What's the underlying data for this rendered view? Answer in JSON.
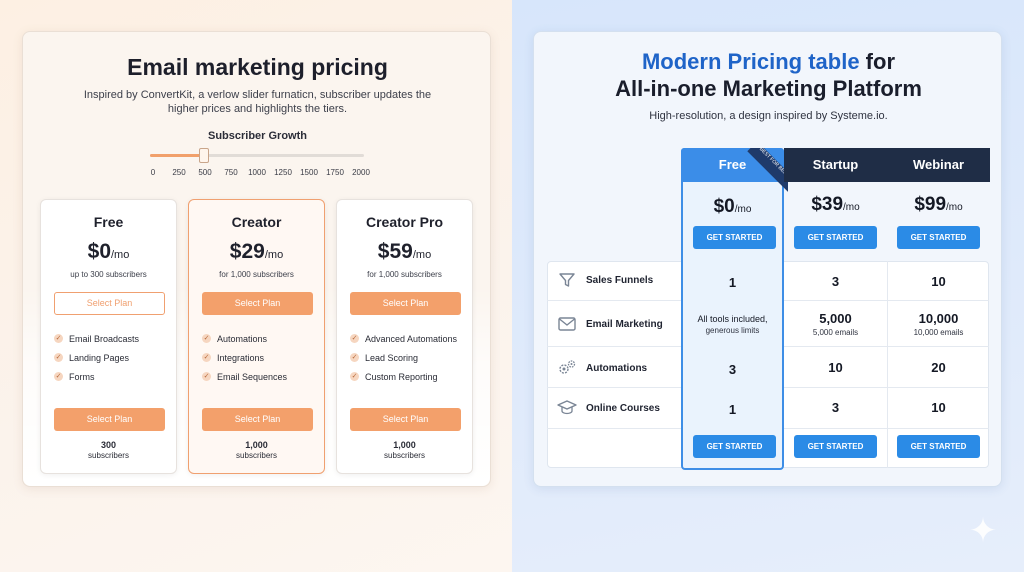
{
  "colors": {
    "accent_orange": "#f3a06b",
    "accent_blue": "#2b8be6",
    "header_dark": "#1f2d46",
    "title_blue": "#1f64c8"
  },
  "left": {
    "title": "Email marketing pricing",
    "subtitle": "Inspired by ConvertKit, a verlow slider furnaticn, subscriber updates the higher prices and highlights the tiers.",
    "slider": {
      "label": "Subscriber Growth",
      "value": 500,
      "max": 2000,
      "ticks": [
        "0",
        "250",
        "500",
        "750",
        "1000",
        "1250",
        "1500",
        "1750",
        "2000"
      ]
    },
    "plans": [
      {
        "name": "Free",
        "price": "$0",
        "per": "/mo",
        "limit": "up to 300 subscribers",
        "top_button": "Select Plan",
        "features": [
          "Email Broadcasts",
          "Landing Pages",
          "Forms"
        ],
        "bottom_button": "Select Plan",
        "subs_count": "300",
        "subs_label": "subscribers"
      },
      {
        "name": "Creator",
        "price": "$29",
        "per": "/mo",
        "limit": "for 1,000 subscribers",
        "top_button": "Select Plan",
        "features": [
          "Automations",
          "Integrations",
          "Email Sequences"
        ],
        "bottom_button": "Select Plan",
        "subs_count": "1,000",
        "subs_label": "subscribers"
      },
      {
        "name": "Creator Pro",
        "price": "$59",
        "per": "/mo",
        "limit": "for 1,000 subscribers",
        "top_button": "Select Plan",
        "features": [
          "Advanced Automations",
          "Lead Scoring",
          "Custom Reporting"
        ],
        "bottom_button": "Select Plan",
        "subs_count": "1,000",
        "subs_label": "subscribers"
      }
    ]
  },
  "right": {
    "title_highlight": "Modern Pricing table",
    "title_rest": " for",
    "title_line2": "All-in-one Marketing Platform",
    "subtitle": "High-resolution, a design inspired by Systeme.io.",
    "ribbon": "BEST FOR BEGINNERS",
    "columns": [
      {
        "name": "Free",
        "price": "$0",
        "per": "/mo",
        "button": "GET STARTED"
      },
      {
        "name": "Startup",
        "price": "$39",
        "per": "/mo",
        "button": "GET STARTED"
      },
      {
        "name": "Webinar",
        "price": "$99",
        "per": "/mo",
        "button": "GET STARTED"
      }
    ],
    "features": [
      {
        "label": "Sales Funnels",
        "icon": "funnel-icon"
      },
      {
        "label": "Email Marketing",
        "icon": "envelope-icon"
      },
      {
        "label": "Automations",
        "icon": "gears-icon"
      },
      {
        "label": "Online Courses",
        "icon": "graduation-cap-icon"
      }
    ],
    "cells": {
      "funnels": [
        "1",
        "3",
        "10"
      ],
      "email_free_line1": "All tools included,",
      "email_free_line2": "generous limits",
      "email_startup": "5,000",
      "email_startup_sub": "5,000 emails",
      "email_webinar": "10,000",
      "email_webinar_sub": "10,000 emails",
      "automations": [
        "3",
        "10",
        "20"
      ],
      "courses": [
        "1",
        "3",
        "10"
      ]
    },
    "bottom_button": "GET STARTED"
  }
}
